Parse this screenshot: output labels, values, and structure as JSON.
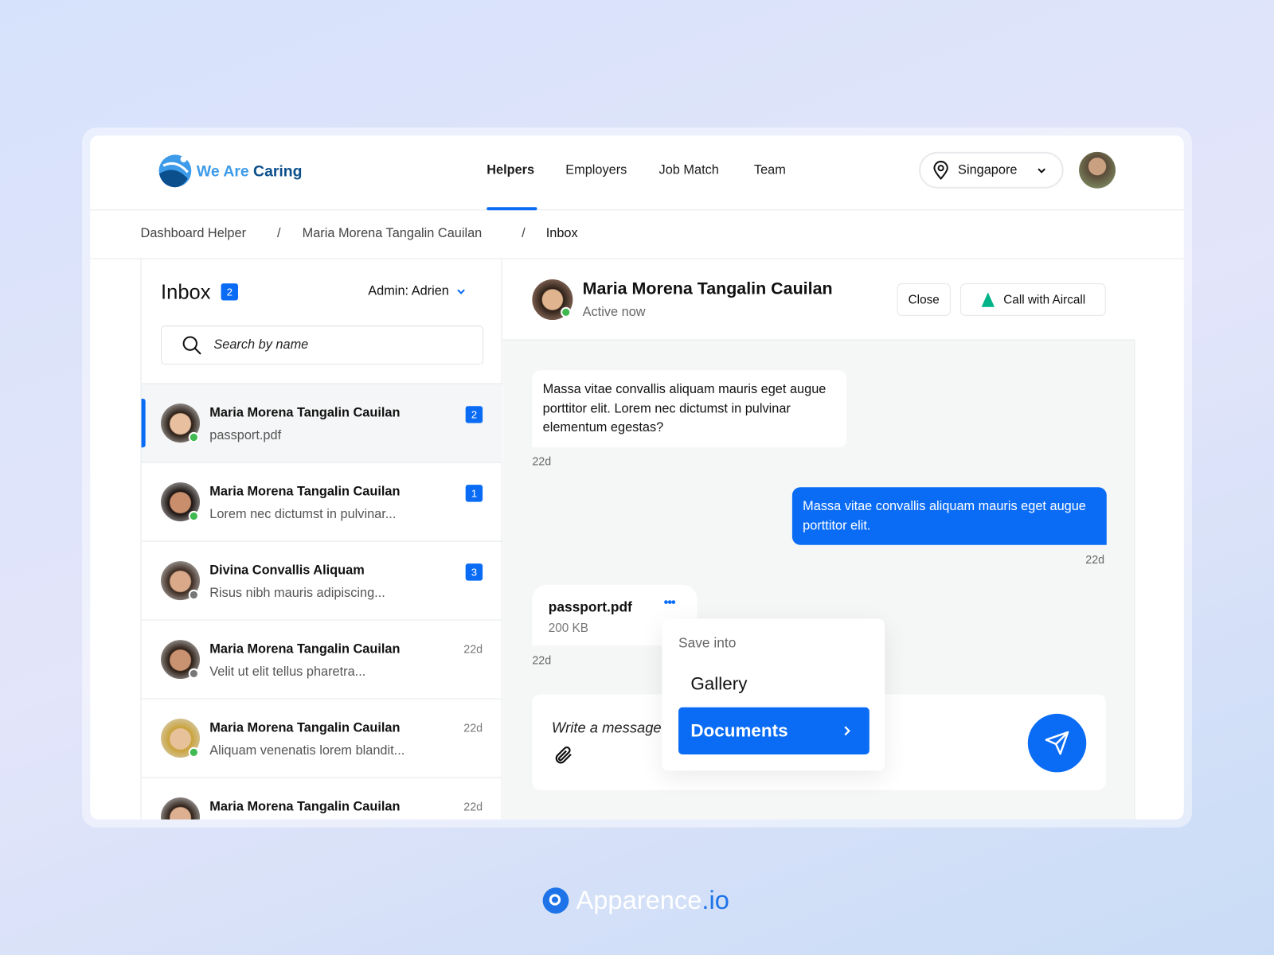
{
  "brand": {
    "name_part1": "We Are",
    "name_part2": "Caring"
  },
  "nav": {
    "items": [
      {
        "label": "Helpers",
        "active": true
      },
      {
        "label": "Employers"
      },
      {
        "label": "Job Match"
      },
      {
        "label": "Team"
      }
    ]
  },
  "location": {
    "value": "Singapore",
    "icon": "map-pin-icon"
  },
  "breadcrumb": [
    "Dashboard Helper",
    "Maria Morena Tangalin Cauilan",
    "Inbox"
  ],
  "breadcrumb_sep": "/",
  "inbox": {
    "title": "Inbox",
    "count": "2",
    "admin": "Admin: Adrien",
    "search_placeholder": "Search by name",
    "items": [
      {
        "name": "Maria Morena Tangalin Cauilan",
        "preview": "passport.pdf",
        "badge": "2",
        "online": true,
        "selected": true
      },
      {
        "name": "Maria Morena Tangalin Cauilan",
        "preview": "Lorem nec dictumst in pulvinar...",
        "badge": "1",
        "online": true
      },
      {
        "name": "Divina Convallis Aliquam",
        "preview": "Risus nibh mauris adipiscing...",
        "badge": "3",
        "online": false
      },
      {
        "name": "Maria Morena Tangalin Cauilan",
        "preview": "Velit ut elit tellus pharetra...",
        "time": "22d",
        "online": false
      },
      {
        "name": "Maria Morena Tangalin Cauilan",
        "preview": "Aliquam venenatis lorem blandit...",
        "time": "22d",
        "online": true
      },
      {
        "name": "Maria Morena Tangalin Cauilan",
        "preview": "",
        "time": "22d",
        "online": true
      }
    ]
  },
  "chat": {
    "name": "Maria Morena Tangalin Cauilan",
    "status": "Active now",
    "close_label": "Close",
    "call_label": "Call with Aircall",
    "messages": [
      {
        "text": "Massa vitae convallis aliquam mauris eget augue porttitor elit. Lorem nec dictumst in pulvinar elementum egestas?",
        "time": "22d",
        "direction": "incoming"
      },
      {
        "text": "Massa vitae convallis aliquam mauris eget augue porttitor elit.",
        "time": "22d",
        "direction": "outgoing"
      }
    ],
    "file": {
      "name": "passport.pdf",
      "size": "200 KB",
      "time": "22d"
    },
    "composer_placeholder": "Write a message",
    "save_menu": {
      "title": "Save into",
      "options": [
        {
          "label": "Gallery"
        },
        {
          "label": "Documents",
          "selected": true
        }
      ]
    }
  },
  "footer_brand": {
    "part1": "Apparence",
    "part2": ".io"
  },
  "colors": {
    "accent": "#0a6cf5",
    "online": "#3fb950",
    "offline": "#777777"
  }
}
